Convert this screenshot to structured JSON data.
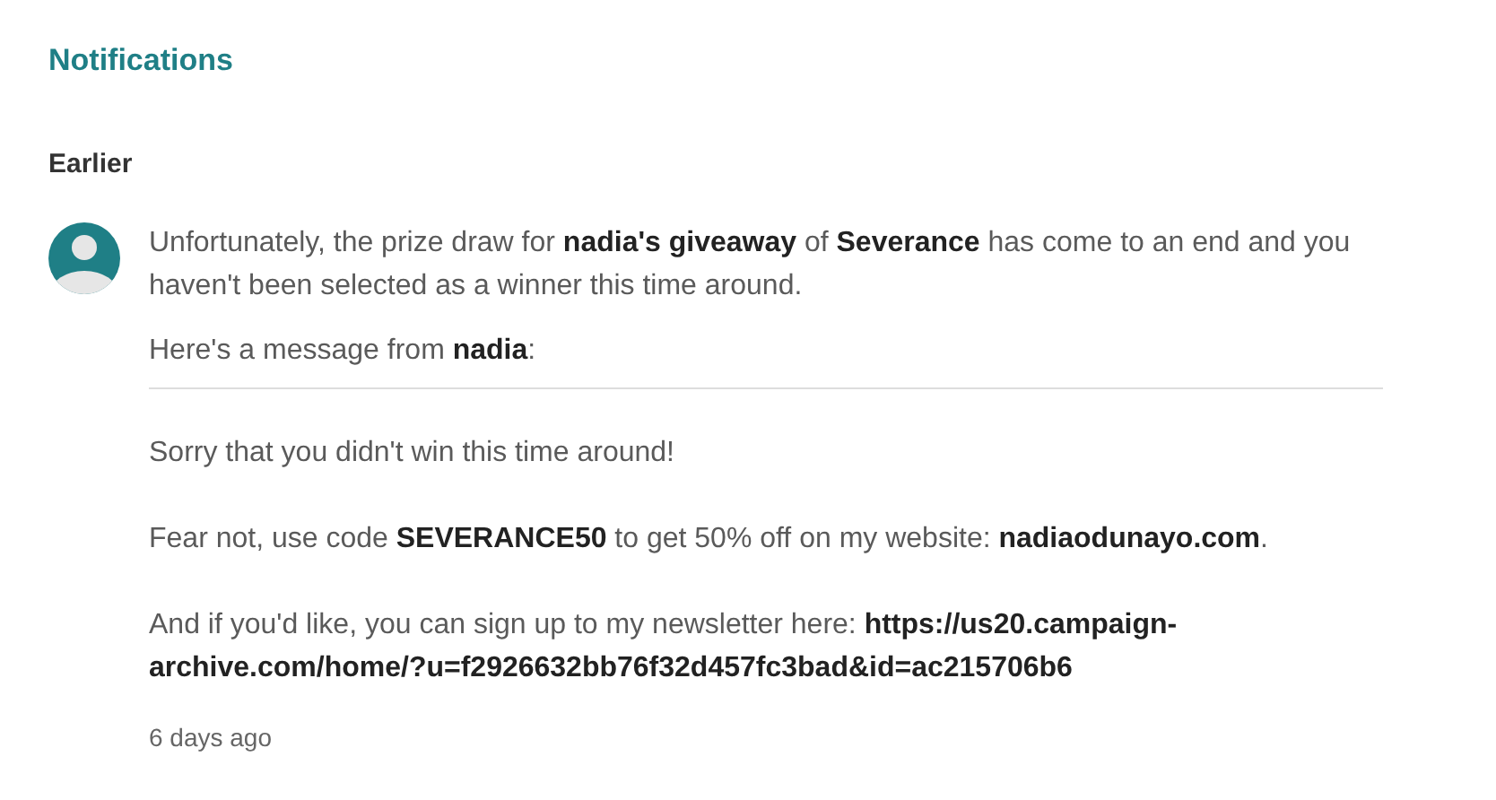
{
  "title": "Notifications",
  "section": "Earlier",
  "notification": {
    "summary": "Unfortunately, the prize draw for **nadia's giveaway** of **Severance** has come to an end and you haven't been selected as a winner this time around.",
    "intro": "Here's a message from **nadia**:",
    "message": [
      "Sorry that you didn't win this time around!",
      "Fear not, use code **SEVERANCE50** to get 50% off on my website: **nadiaodunayo.com**.",
      "And if you'd like, you can sign up to my newsletter here: **https://us20.campaign-archive.com/home/?u=f2926632bb76f32d457fc3bad&id=ac215706b6**"
    ],
    "time": "6 days ago"
  }
}
